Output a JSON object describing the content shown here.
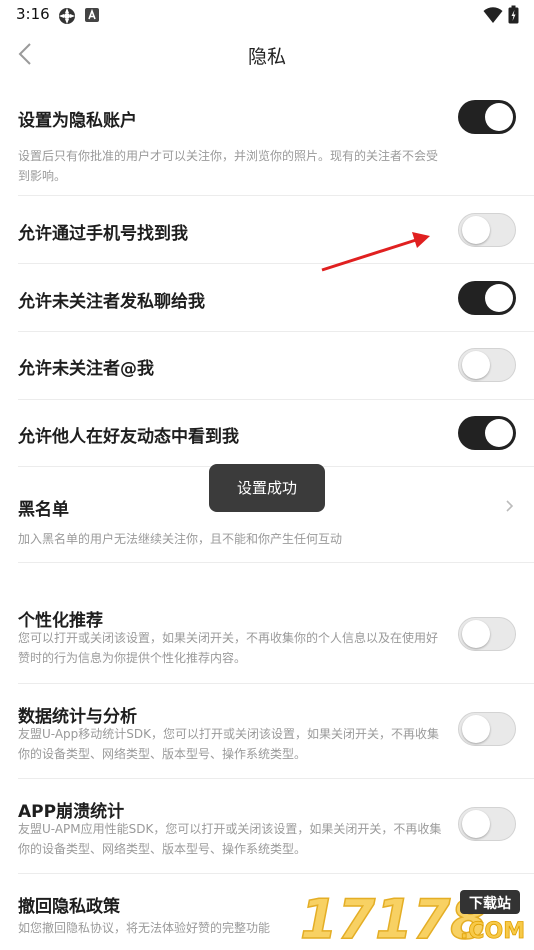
{
  "status_bar": {
    "time": "3:16"
  },
  "header": {
    "title": "隐私"
  },
  "settings": {
    "private_account": {
      "title": "设置为隐私账户",
      "desc": "设置后只有你批准的用户才可以关注你，并浏览你的照片。现有的关注者不会受到影响。",
      "enabled": true
    },
    "find_by_phone": {
      "title": "允许通过手机号找到我",
      "enabled": false
    },
    "dm_from_non_followers": {
      "title": "允许未关注者发私聊给我",
      "enabled": true
    },
    "mention_by_non_followers": {
      "title": "允许未关注者@我",
      "enabled": false
    },
    "visible_in_friend_feed": {
      "title": "允许他人在好友动态中看到我",
      "enabled": true
    },
    "blacklist": {
      "title": "黑名单",
      "desc": "加入黑名单的用户无法继续关注你，且不能和你产生任何互动"
    },
    "personalized": {
      "title": "个性化推荐",
      "desc": "您可以打开或关闭该设置，如果关闭开关，不再收集你的个人信息以及在使用好赞时的行为信息为你提供个性化推荐内容。",
      "enabled": false
    },
    "analytics": {
      "title": "数据统计与分析",
      "desc": "友盟U-App移动统计SDK，您可以打开或关闭该设置，如果关闭开关，不再收集你的设备类型、网络类型、版本型号、操作系统类型。",
      "enabled": false
    },
    "crash_stats": {
      "title": "APP崩溃统计",
      "desc": "友盟U-APM应用性能SDK，您可以打开或关闭该设置，如果关闭开关，不再收集你的设备类型、网络类型、版本型号、操作系统类型。",
      "enabled": false
    },
    "revoke": {
      "title": "撤回隐私政策",
      "desc": "如您撤回隐私协议，将无法体验好赞的完整功能"
    }
  },
  "toast": "设置成功",
  "watermark": {
    "text": "17178",
    "badge": "下载站",
    "domain": ".COM"
  },
  "colors": {
    "toggle_on": "#222222",
    "toggle_off": "#e9e9e9",
    "annotation_arrow": "#e02020",
    "watermark": "#f2a900"
  }
}
